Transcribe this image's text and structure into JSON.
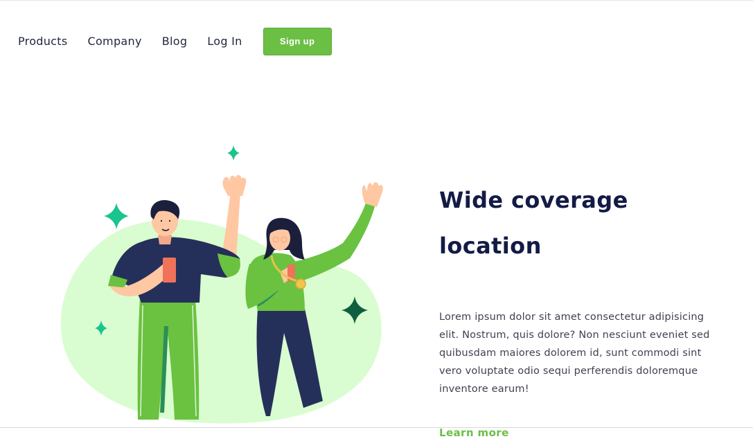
{
  "nav": {
    "links": [
      "Products",
      "Company",
      "Blog",
      "Log In"
    ],
    "signup_label": "Sign up"
  },
  "hero": {
    "headline_line1": "Wide coverage",
    "headline_line2": "location",
    "description": "Lorem ipsum dolor sit amet consectetur adipisicing elit. Nostrum, quis dolore? Non nesciunt eveniet sed quibusdam maiores dolorem id, sunt commodi sint vero voluptate odio sequi perferendis doloremque inventore earum!",
    "cta_label": "Learn more"
  },
  "colors": {
    "accent": "#6cbf45",
    "heading": "#131b45",
    "blob": "#d9fdd0",
    "sparkle_teal": "#1ac48e",
    "sparkle_dark": "#0f5e40",
    "navy": "#25305a"
  },
  "illustration": {
    "icon": "two-people-waving-illustration"
  }
}
